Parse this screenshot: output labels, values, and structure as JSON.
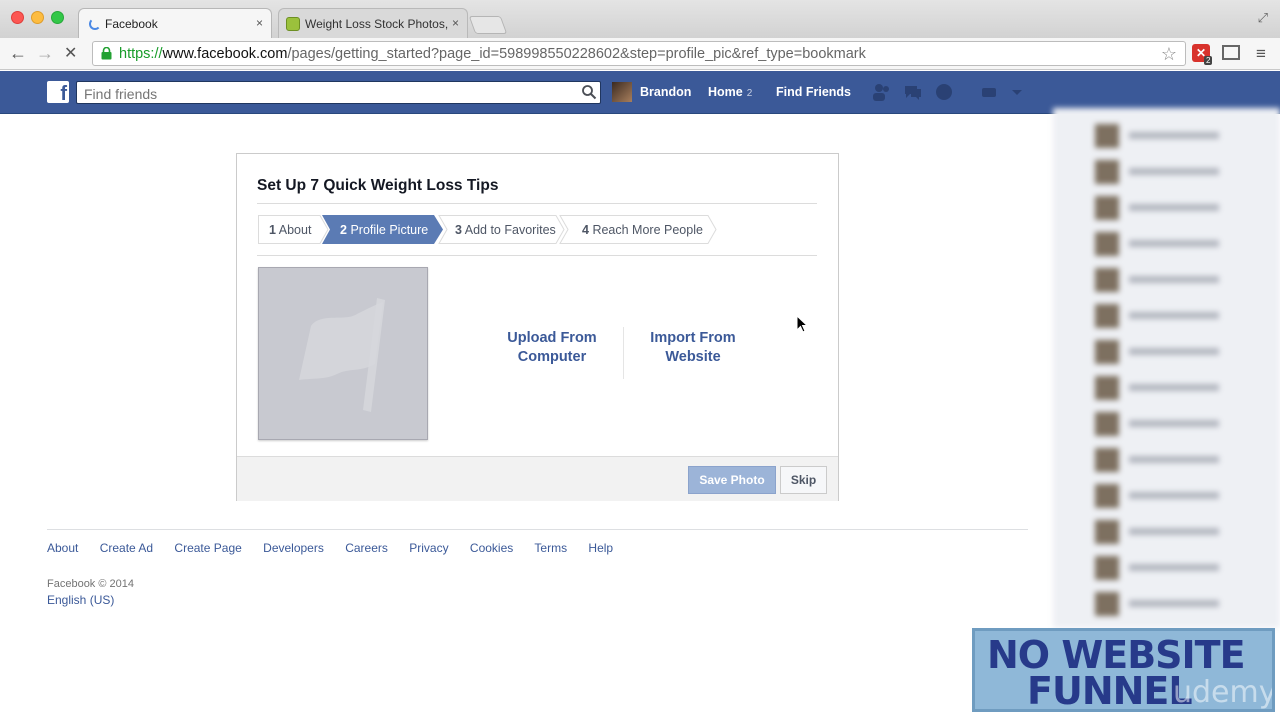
{
  "browser": {
    "tabs": [
      {
        "title": "Facebook",
        "close": "×",
        "active": true
      },
      {
        "title": "Weight Loss Stock Photos,",
        "close": "×",
        "active": false
      }
    ],
    "url": {
      "scheme": "https://",
      "host": "www.facebook.com",
      "path": "/pages/getting_started?page_id=598998550228602&step=profile_pic&ref_type=bookmark"
    },
    "extension_badge": "2",
    "icons": [
      "back-icon",
      "forward-icon",
      "stop-icon",
      "lock-icon",
      "star-icon",
      "menu-icon"
    ]
  },
  "fb_header": {
    "search_placeholder": "Find friends",
    "user_name": "Brandon",
    "home_label": "Home",
    "home_count": "2",
    "find_friends_label": "Find Friends"
  },
  "setup": {
    "title": "Set Up 7 Quick Weight Loss Tips",
    "steps": [
      {
        "num": "1",
        "label": "About",
        "active": false
      },
      {
        "num": "2",
        "label": "Profile Picture",
        "active": true
      },
      {
        "num": "3",
        "label": "Add to Favorites",
        "active": false
      },
      {
        "num": "4",
        "label": "Reach More People",
        "active": false
      }
    ],
    "upload_computer": [
      "Upload From",
      "Computer"
    ],
    "import_website": [
      "Import From",
      "Website"
    ],
    "save_button": "Save Photo",
    "skip_button": "Skip"
  },
  "footer": {
    "links": [
      "About",
      "Create Ad",
      "Create Page",
      "Developers",
      "Careers",
      "Privacy",
      "Cookies",
      "Terms",
      "Help"
    ],
    "copyright": "Facebook © 2014",
    "language": "English (US)"
  },
  "watermark": {
    "line1": "NO WEBSITE",
    "line2": "FUNNEL",
    "brand": "udemy"
  },
  "colors": {
    "fb_blue": "#3b5998",
    "active_step": "#5b7bb4",
    "save_disabled": "#9cb4d8"
  }
}
